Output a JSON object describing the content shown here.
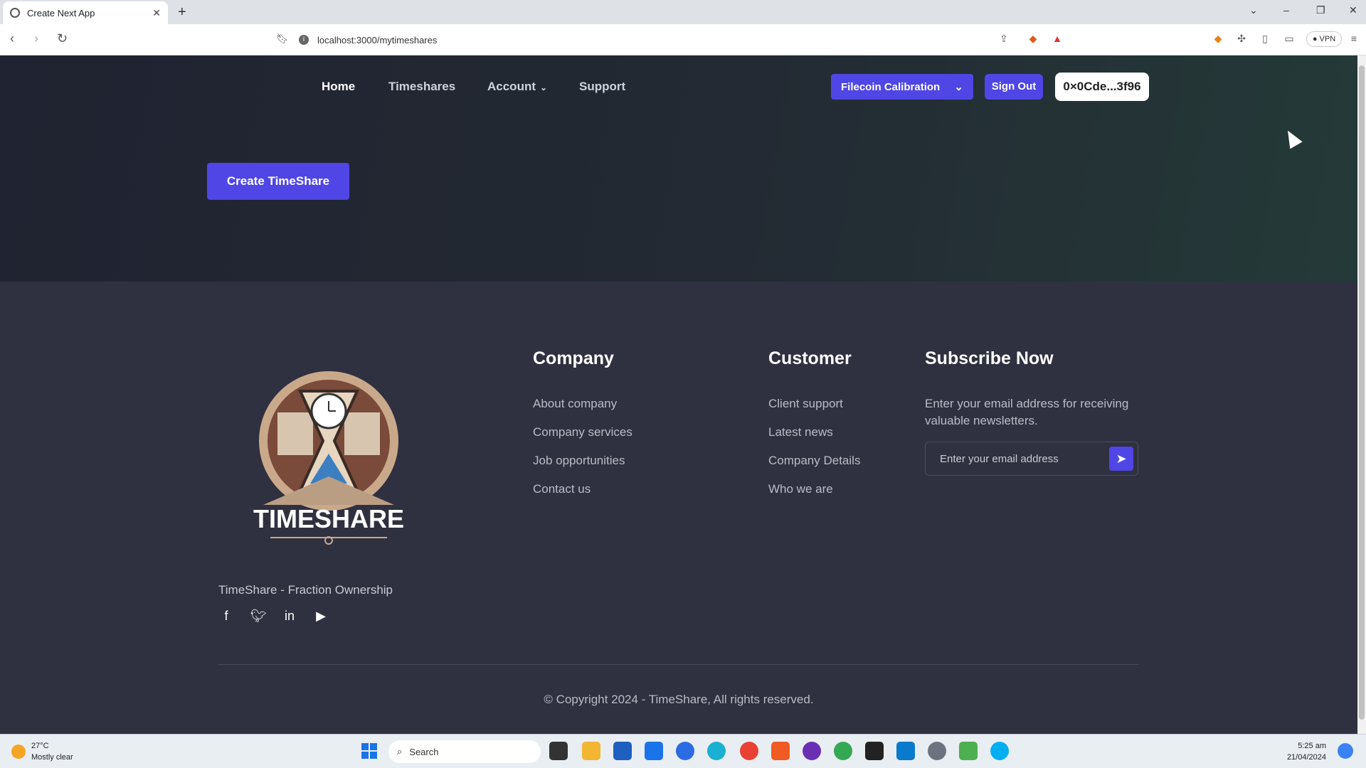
{
  "browser": {
    "tab_title": "Create Next App",
    "url": "localhost:3000/mytimeshares",
    "vpn_label": "VPN"
  },
  "nav": {
    "items": [
      "Home",
      "Timeshares",
      "Account",
      "Support"
    ],
    "network_select": "Filecoin Calibration",
    "signout_label": "Sign Out",
    "wallet_address": "0×0Cde...3f96"
  },
  "hero": {
    "create_label": "Create TimeShare"
  },
  "footer": {
    "logo_text": "TIMESHARE",
    "tagline": "TimeShare - Fraction Ownership",
    "company": {
      "heading": "Company",
      "links": [
        "About company",
        "Company services",
        "Job opportunities",
        "Contact us"
      ]
    },
    "customer": {
      "heading": "Customer",
      "links": [
        "Client support",
        "Latest news",
        "Company Details",
        "Who we are"
      ]
    },
    "subscribe": {
      "heading": "Subscribe Now",
      "text": "Enter your email address for receiving valuable newsletters.",
      "placeholder": "Enter your email address"
    },
    "social_icons": [
      "facebook-icon",
      "twitter-icon",
      "linkedin-icon",
      "youtube-icon"
    ],
    "copyright": "© Copyright 2024 - TimeShare, All rights reserved."
  },
  "taskbar": {
    "temperature": "27°C",
    "weather": "Mostly clear",
    "search_label": "Search",
    "time": "5:25 am",
    "date": "21/04/2024"
  },
  "colors": {
    "accent": "#4f46e5",
    "footer_bg": "#2f3140",
    "hero_bg": "#222834"
  }
}
